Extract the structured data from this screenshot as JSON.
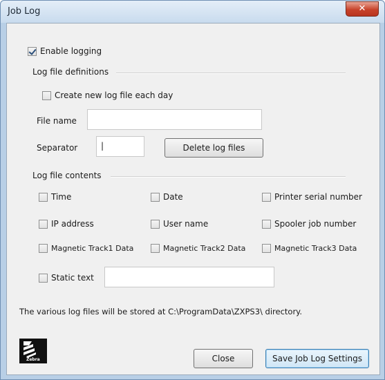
{
  "window": {
    "title": "Job Log",
    "close_glyph": "✕"
  },
  "logging": {
    "enable_label": "Enable logging",
    "enabled": true
  },
  "definitions": {
    "section_label": "Log file definitions",
    "new_each_day_label": "Create new log file each day",
    "new_each_day_checked": false,
    "file_name_label": "File name",
    "file_name_value": "",
    "separator_label": "Separator",
    "separator_value": "|",
    "delete_button": "Delete log files"
  },
  "contents": {
    "section_label": "Log file contents",
    "options": [
      {
        "label": "Time",
        "checked": false
      },
      {
        "label": "Date",
        "checked": false
      },
      {
        "label": "Printer serial number",
        "checked": false
      },
      {
        "label": "IP address",
        "checked": false
      },
      {
        "label": "User name",
        "checked": false
      },
      {
        "label": "Spooler job number",
        "checked": false
      },
      {
        "label": "Magnetic Track1 Data",
        "checked": false
      },
      {
        "label": "Magnetic Track2 Data",
        "checked": false
      },
      {
        "label": "Magnetic Track3 Data",
        "checked": false
      }
    ],
    "static_text_label": "Static text",
    "static_text_value": ""
  },
  "info": {
    "storage_note": "The various log files will be stored at C:\\ProgramData\\ZXPS3\\ directory."
  },
  "footer": {
    "logo_text": "Zebra",
    "close_button": "Close",
    "save_button": "Save Job Log Settings"
  }
}
